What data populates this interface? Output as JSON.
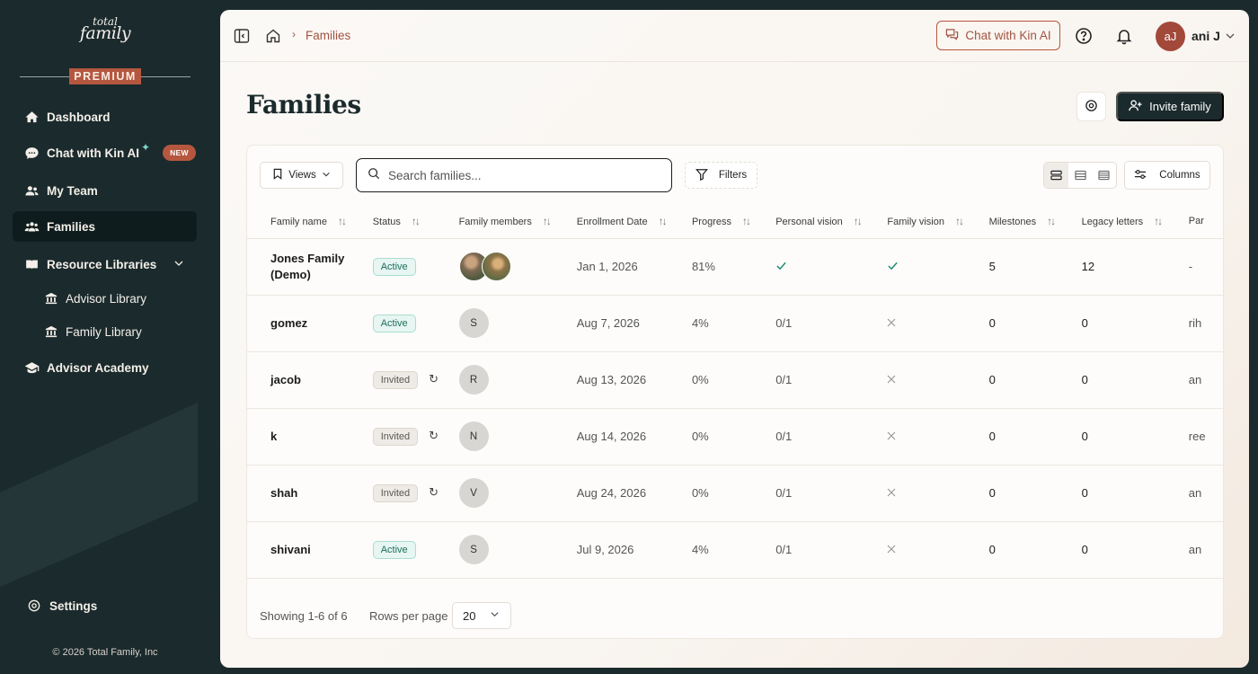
{
  "brand": {
    "logo_line1": "total",
    "logo_line2": "family",
    "tier": "PREMIUM"
  },
  "sidebar": {
    "items": [
      {
        "label": "Dashboard",
        "icon": "home-icon"
      },
      {
        "label": "Chat with Kin AI",
        "icon": "chat-bubble-icon",
        "badge": "NEW"
      },
      {
        "label": "My Team",
        "icon": "team-icon"
      },
      {
        "label": "Families",
        "icon": "families-icon",
        "active": true
      },
      {
        "label": "Resource Libraries",
        "icon": "book-icon",
        "expanded": true
      },
      {
        "label": "Advisor Academy",
        "icon": "graduation-cap-icon"
      }
    ],
    "sub_items": [
      {
        "label": "Advisor Library",
        "icon": "library-icon"
      },
      {
        "label": "Family Library",
        "icon": "library-icon"
      }
    ],
    "settings_label": "Settings",
    "copyright": "© 2026 Total Family, Inc"
  },
  "topbar": {
    "breadcrumb_current": "Families",
    "chat_button": "Chat with Kin AI",
    "user_initials": "aJ",
    "user_name": "ani J"
  },
  "page": {
    "title": "Families",
    "invite_button": "Invite family"
  },
  "toolbar": {
    "views_label": "Views",
    "search_placeholder": "Search families...",
    "filters_label": "Filters",
    "columns_label": "Columns"
  },
  "table": {
    "columns": [
      "Family name",
      "Status",
      "Family members",
      "Enrollment Date",
      "Progress",
      "Personal vision",
      "Family vision",
      "Milestones",
      "Legacy letters",
      "Par"
    ],
    "rows": [
      {
        "name": "Jones Family (Demo)",
        "status": "Active",
        "members": "photos",
        "date": "Jan 1, 2026",
        "progress": "81%",
        "personal_vision": "check",
        "family_vision": "check",
        "milestones": "5",
        "legacy_letters": "12",
        "partial": "-"
      },
      {
        "name": "gomez",
        "status": "Active",
        "members": "S",
        "date": "Aug 7, 2026",
        "progress": "4%",
        "personal_vision": "0/1",
        "family_vision": "x",
        "milestones": "0",
        "legacy_letters": "0",
        "partial": "rih"
      },
      {
        "name": "jacob",
        "status": "Invited",
        "members": "R",
        "date": "Aug 13, 2026",
        "progress": "0%",
        "personal_vision": "0/1",
        "family_vision": "x",
        "milestones": "0",
        "legacy_letters": "0",
        "partial": "an"
      },
      {
        "name": "k",
        "status": "Invited",
        "members": "N",
        "date": "Aug 14, 2026",
        "progress": "0%",
        "personal_vision": "0/1",
        "family_vision": "x",
        "milestones": "0",
        "legacy_letters": "0",
        "partial": "ree"
      },
      {
        "name": "shah",
        "status": "Invited",
        "members": "V",
        "date": "Aug 24, 2026",
        "progress": "0%",
        "personal_vision": "0/1",
        "family_vision": "x",
        "milestones": "0",
        "legacy_letters": "0",
        "partial": "an"
      },
      {
        "name": "shivani",
        "status": "Active",
        "members": "S",
        "date": "Jul 9, 2026",
        "progress": "4%",
        "personal_vision": "0/1",
        "family_vision": "x",
        "milestones": "0",
        "legacy_letters": "0",
        "partial": "an"
      }
    ]
  },
  "footer": {
    "showing": "Showing 1-6 of 6",
    "rows_per_page_label": "Rows per page",
    "rows_per_page_value": "20"
  },
  "colors": {
    "sidebar_bg": "#1b2a2c",
    "accent": "#b5573f",
    "active_green": "#1d6e5c"
  }
}
